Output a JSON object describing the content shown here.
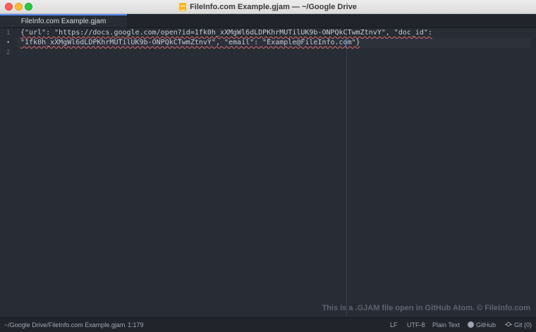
{
  "window": {
    "title": "FileInfo.com Example.gjam — ~/Google Drive"
  },
  "tabs": [
    {
      "label": "FileInfo.com Example.gjam"
    }
  ],
  "editor": {
    "gutter": [
      "1",
      "•",
      "2"
    ],
    "lines": [
      "{\"url\": \"https://docs.google.com/open?id=1fk0h_xXMgWl6dLDPKhrMUTilUK9b-ONPQkCTwmZtnvY\", \"doc_id\":",
      "\"1fk0h_xXMgWl6dLDPKhrMUTilUK9b-ONPQkCTwmZtnvY\", \"email\": \"Example@FileInfo.com\"}"
    ]
  },
  "watermark": "This is a .GJAM file open in GitHub Atom. © FileInfo.com",
  "status_bar": {
    "file_path": "~/Google Drive/FileInfo.com Example.gjam",
    "cursor_position": "1:179",
    "line_ending": "LF",
    "encoding": "UTF-8",
    "grammar": "Plain Text",
    "github_label": "GitHub",
    "git_label": "Git (0)"
  },
  "icons": {
    "app": "document-icon",
    "github": "github-icon",
    "git": "git-branch-icon"
  },
  "colors": {
    "accent": "#568af2",
    "editor_bg": "#282c34",
    "squiggle": "#e06c75"
  }
}
